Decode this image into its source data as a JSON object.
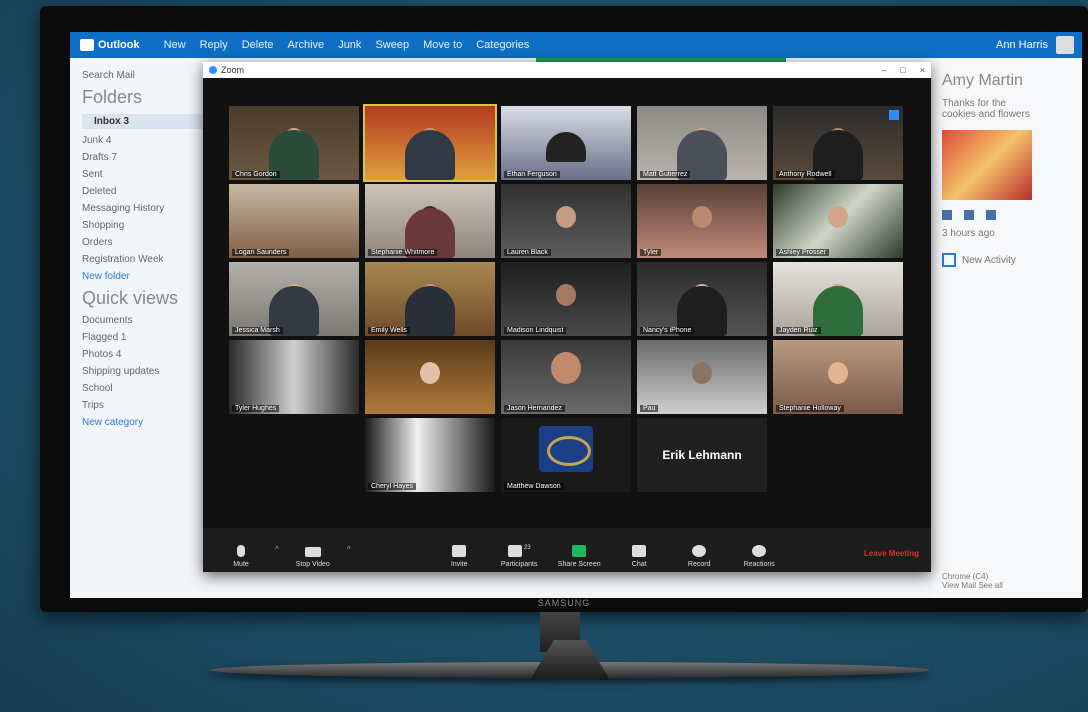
{
  "outlook": {
    "brand": "Outlook",
    "menu": [
      "New",
      "Reply",
      "Delete",
      "Archive",
      "Junk",
      "Sweep",
      "Move to",
      "Categories"
    ],
    "user_name": "Ann Harris",
    "sidebar": {
      "search": "Search Mail",
      "folders_heading": "Folders",
      "items": [
        "Inbox 3",
        "Junk 4",
        "Drafts 7",
        "Sent",
        "Deleted",
        "Messaging History",
        "Shopping",
        "Orders",
        "Registration Week",
        "New folder"
      ],
      "quick_heading": "Quick views",
      "quick_items": [
        "Documents",
        "Flagged 1",
        "Photos 4",
        "Shipping updates",
        "School",
        "Trips",
        "New category"
      ]
    },
    "right": {
      "name": "Amy Martin",
      "lines": [
        "Thanks for the",
        "cookies and flowers"
      ],
      "time": "3 hours ago",
      "checkbox": "New Activity",
      "footer": [
        "Chrome (C4)",
        "View Mail",
        "See all"
      ]
    }
  },
  "zoom": {
    "title": "Zoom",
    "window_controls": [
      "–",
      "□",
      "×"
    ],
    "participants": [
      "Chris Gordon",
      "",
      "Ethan Ferguson",
      "Matt Gutierrez",
      "Anthony Rodwell",
      "Logan Saunders",
      "Stephanie Whitmore",
      "Lauren Black",
      "Tyler",
      "Ashley Prosser",
      "Jessica Marsh",
      "Emily Wells",
      "Madison Lindquist",
      "Nancy's iPhone",
      "Jayden Ruiz",
      "Tyler Hughes",
      "",
      "Jason Hernandez",
      "Pau",
      "Stephanie Holloway",
      "Cheryl Hayes",
      "Matthew Dawson",
      "Erik Lehmann"
    ],
    "toolbar": {
      "mute": "Mute",
      "stop_video": "Stop Video",
      "invite": "Invite",
      "participants": "Participants",
      "participants_count": "23",
      "share": "Share Screen",
      "chat": "Chat",
      "record": "Record",
      "reactions": "Reactions",
      "end": "Leave Meeting"
    }
  },
  "tv_brand": "SAMSUNG",
  "colors": {
    "outlook_blue": "#0f6fc6",
    "zoom_dark": "#1c1c1c",
    "active_speaker": "#d9c44a",
    "end_red": "#e0302e",
    "share_green": "#1fb85f"
  }
}
